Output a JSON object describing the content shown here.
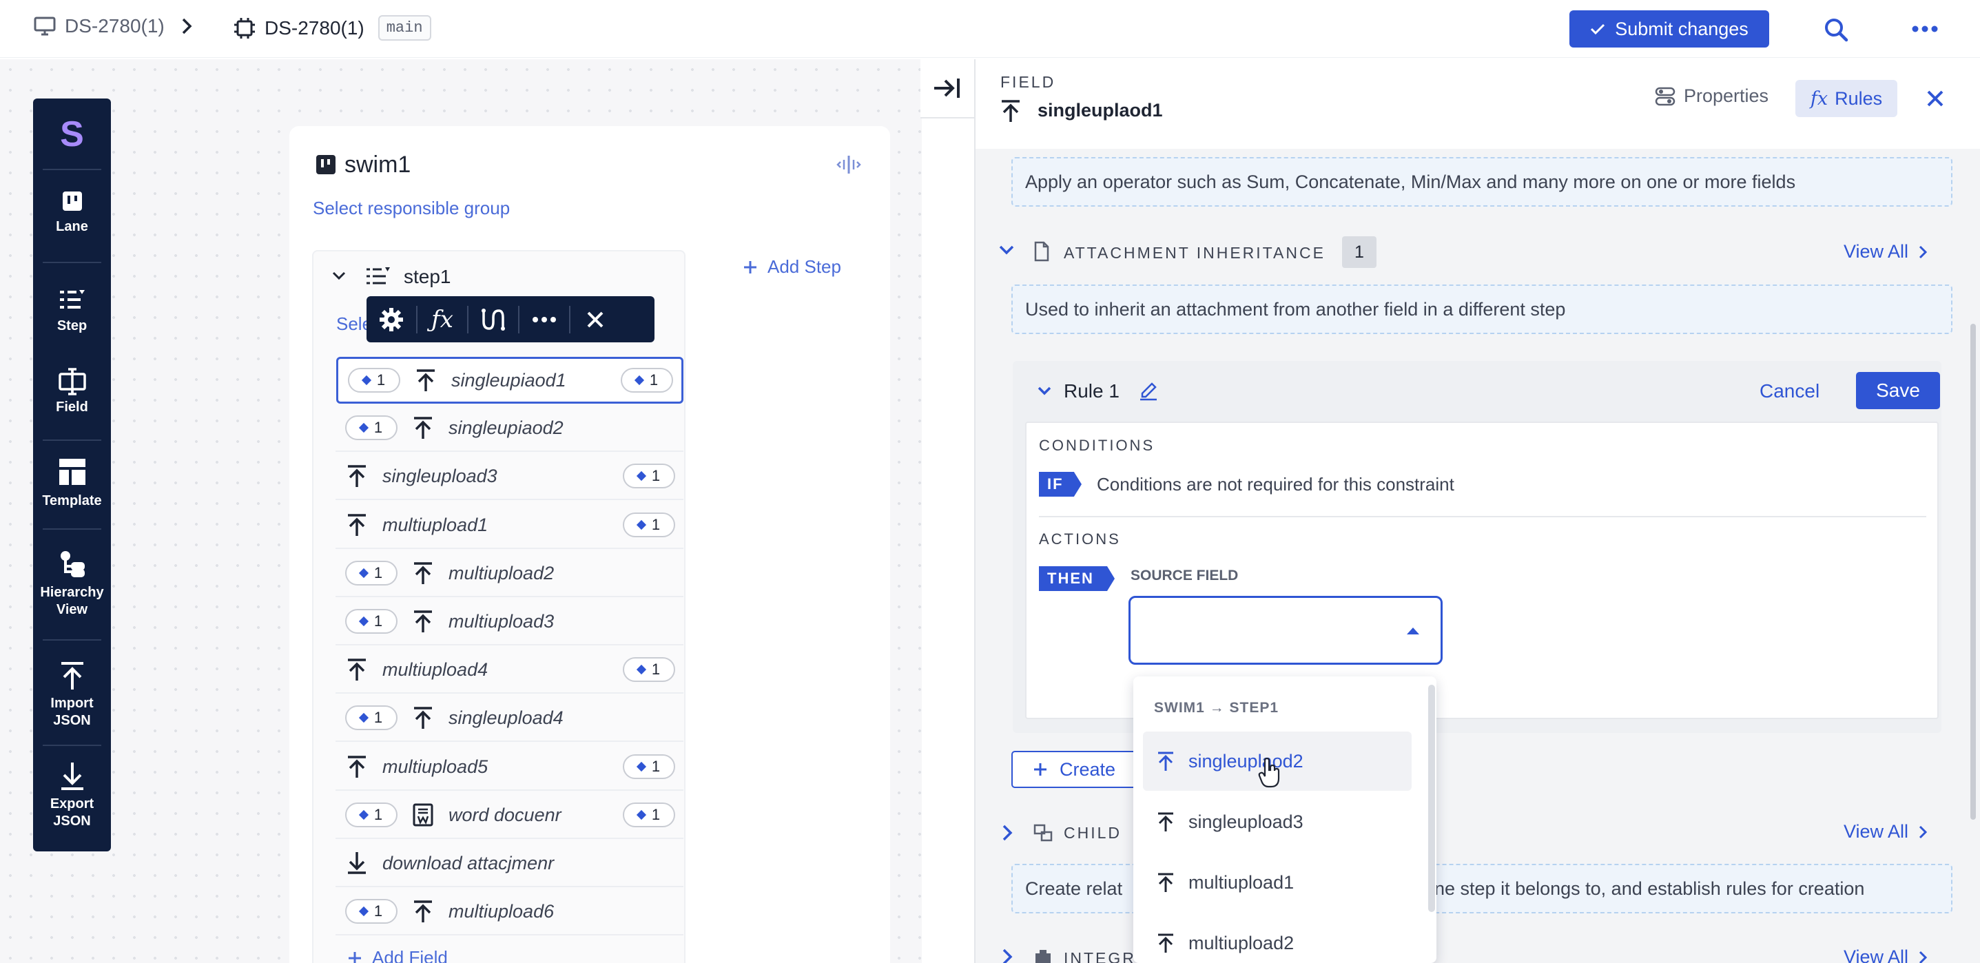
{
  "breadcrumb": {
    "project": "DS-2780(1)",
    "process": "DS-2780(1)",
    "branch": "main"
  },
  "header": {
    "submit_label": "Submit changes"
  },
  "toolbar": {
    "logo": "S",
    "items": [
      {
        "label": "Lane"
      },
      {
        "label": "Step"
      },
      {
        "label": "Field"
      },
      {
        "label": "Template"
      },
      {
        "label": "Hierarchy View"
      },
      {
        "label": "Import JSON"
      },
      {
        "label": "Export JSON"
      }
    ]
  },
  "lane": {
    "title": "swim1",
    "responsible_group": "Select responsible group",
    "add_step": "Add Step",
    "step": {
      "title": "step1",
      "select_label": "Sele"
    },
    "fields": [
      {
        "name": "singleupiaod1",
        "left_count": "1",
        "right_count": "1",
        "icon": "upload-icon"
      },
      {
        "name": "singleupiaod2",
        "left_count": "1",
        "right_count": "",
        "icon": "upload-icon"
      },
      {
        "name": "singleupload3",
        "left_count": "",
        "right_count": "1",
        "icon": "upload-icon"
      },
      {
        "name": "multiupload1",
        "left_count": "",
        "right_count": "1",
        "icon": "upload-icon"
      },
      {
        "name": "multiupload2",
        "left_count": "1",
        "right_count": "",
        "icon": "upload-icon"
      },
      {
        "name": "multiupload3",
        "left_count": "1",
        "right_count": "",
        "icon": "upload-icon"
      },
      {
        "name": "multiupload4",
        "left_count": "",
        "right_count": "1",
        "icon": "upload-icon"
      },
      {
        "name": "singleupload4",
        "left_count": "1",
        "right_count": "",
        "icon": "upload-icon"
      },
      {
        "name": "multiupload5",
        "left_count": "",
        "right_count": "1",
        "icon": "upload-icon"
      },
      {
        "name": "word docuenr",
        "left_count": "1",
        "right_count": "1",
        "icon": "word-document-icon"
      },
      {
        "name": "download attacjmenr",
        "left_count": "",
        "right_count": "",
        "icon": "download-icon"
      },
      {
        "name": "multiupload6",
        "left_count": "1",
        "right_count": "",
        "icon": "upload-icon"
      }
    ],
    "add_field": "Add Field"
  },
  "panel": {
    "kicker": "FIELD",
    "field_name": "singleuplaod1",
    "tab_properties": "Properties",
    "tab_rules": "Rules",
    "tab_rules_fx": "fx",
    "operator_hint": "Apply an operator such as Sum, Concatenate, Min/Max and many more on one or more fields",
    "attachment": {
      "title": "ATTACHMENT INHERITANCE",
      "count": "1",
      "view_all": "View All",
      "hint": "Used to inherit an attachment from another field in a different step"
    },
    "rule": {
      "title": "Rule 1",
      "cancel": "Cancel",
      "save": "Save",
      "conditions_label": "CONDITIONS",
      "if_tag": "IF",
      "conditions_text": "Conditions are not required for this constraint",
      "actions_label": "ACTIONS",
      "then_tag": "THEN",
      "source_field_label": "SOURCE FIELD",
      "source_field_value": ""
    },
    "create_label": "Create",
    "child": {
      "title": "CHILD",
      "view_all": "View All",
      "hint_left": "Create relat",
      "hint_right": "ne step it belongs to, and establish rules for creation"
    },
    "integration": {
      "title": "INTEGR",
      "view_all": "View All"
    }
  },
  "dropdown": {
    "group_label": "SWIM1 → STEP1",
    "options": [
      "singleuplaod2",
      "singleupload3",
      "multiupload1",
      "multiupload2"
    ],
    "hovered": "singleuplaod2"
  },
  "colors": {
    "accent": "#2f55d4",
    "navy": "#0f1e3d"
  }
}
